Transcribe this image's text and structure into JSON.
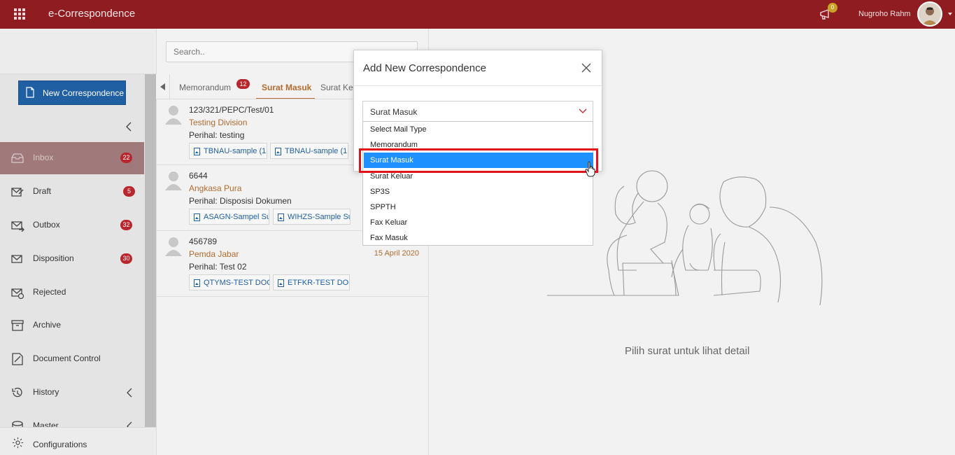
{
  "app": {
    "title": "e-Correspondence"
  },
  "header": {
    "notification_count": "0",
    "user_name": "Nugroho Rahm"
  },
  "sidebar": {
    "new_button_label": "New Correspondence",
    "items": [
      {
        "label": "Inbox",
        "badge": "22"
      },
      {
        "label": "Draft",
        "badge": "5"
      },
      {
        "label": "Outbox",
        "badge": "32"
      },
      {
        "label": "Disposition",
        "badge": "30"
      },
      {
        "label": "Rejected"
      },
      {
        "label": "Archive"
      },
      {
        "label": "Document Control"
      },
      {
        "label": "History"
      },
      {
        "label": "Master"
      }
    ],
    "config_label": "Configurations"
  },
  "search": {
    "placeholder": "Search.."
  },
  "tabs": [
    {
      "label": "Memorandum",
      "badge": "12"
    },
    {
      "label": "Surat Masuk"
    },
    {
      "label": "Surat Ke"
    }
  ],
  "list": [
    {
      "number": "123/321/PEPC/Test/01",
      "org": "Testing Division",
      "perihal": "Perihal: testing",
      "date": "",
      "attachments": [
        "TBNAU-sample (1",
        "TBNAU-sample (1"
      ]
    },
    {
      "number": "6644",
      "org": "Angkasa Pura",
      "perihal": "Perihal: Disposisi Dokumen",
      "date": "",
      "attachments": [
        "ASAGN-Sampel Su",
        "WIHZS-Sample Su"
      ]
    },
    {
      "number": "456789",
      "org": "Pemda Jabar",
      "perihal": "Perihal: Test 02",
      "date": "15 April 2020",
      "attachments": [
        "QTYMS-TEST DOC.",
        "ETFKR-TEST DOC."
      ]
    }
  ],
  "detail": {
    "empty_text": "Pilih surat untuk lihat detail"
  },
  "modal": {
    "title": "Add New Correspondence",
    "select_value": "Surat Masuk",
    "options": [
      "Select Mail Type",
      "Memorandum",
      "Surat Masuk",
      "Surat Keluar",
      "SP3S",
      "SPPTH",
      "Fax Keluar",
      "Fax Masuk"
    ],
    "selected_index": 2
  },
  "colors": {
    "brand": "#8e1c21",
    "primary": "#1f5fa2",
    "accent": "#b36b2f",
    "badge": "#b8272d",
    "selection": "#1e90ff",
    "highlight": "#e1141c"
  }
}
